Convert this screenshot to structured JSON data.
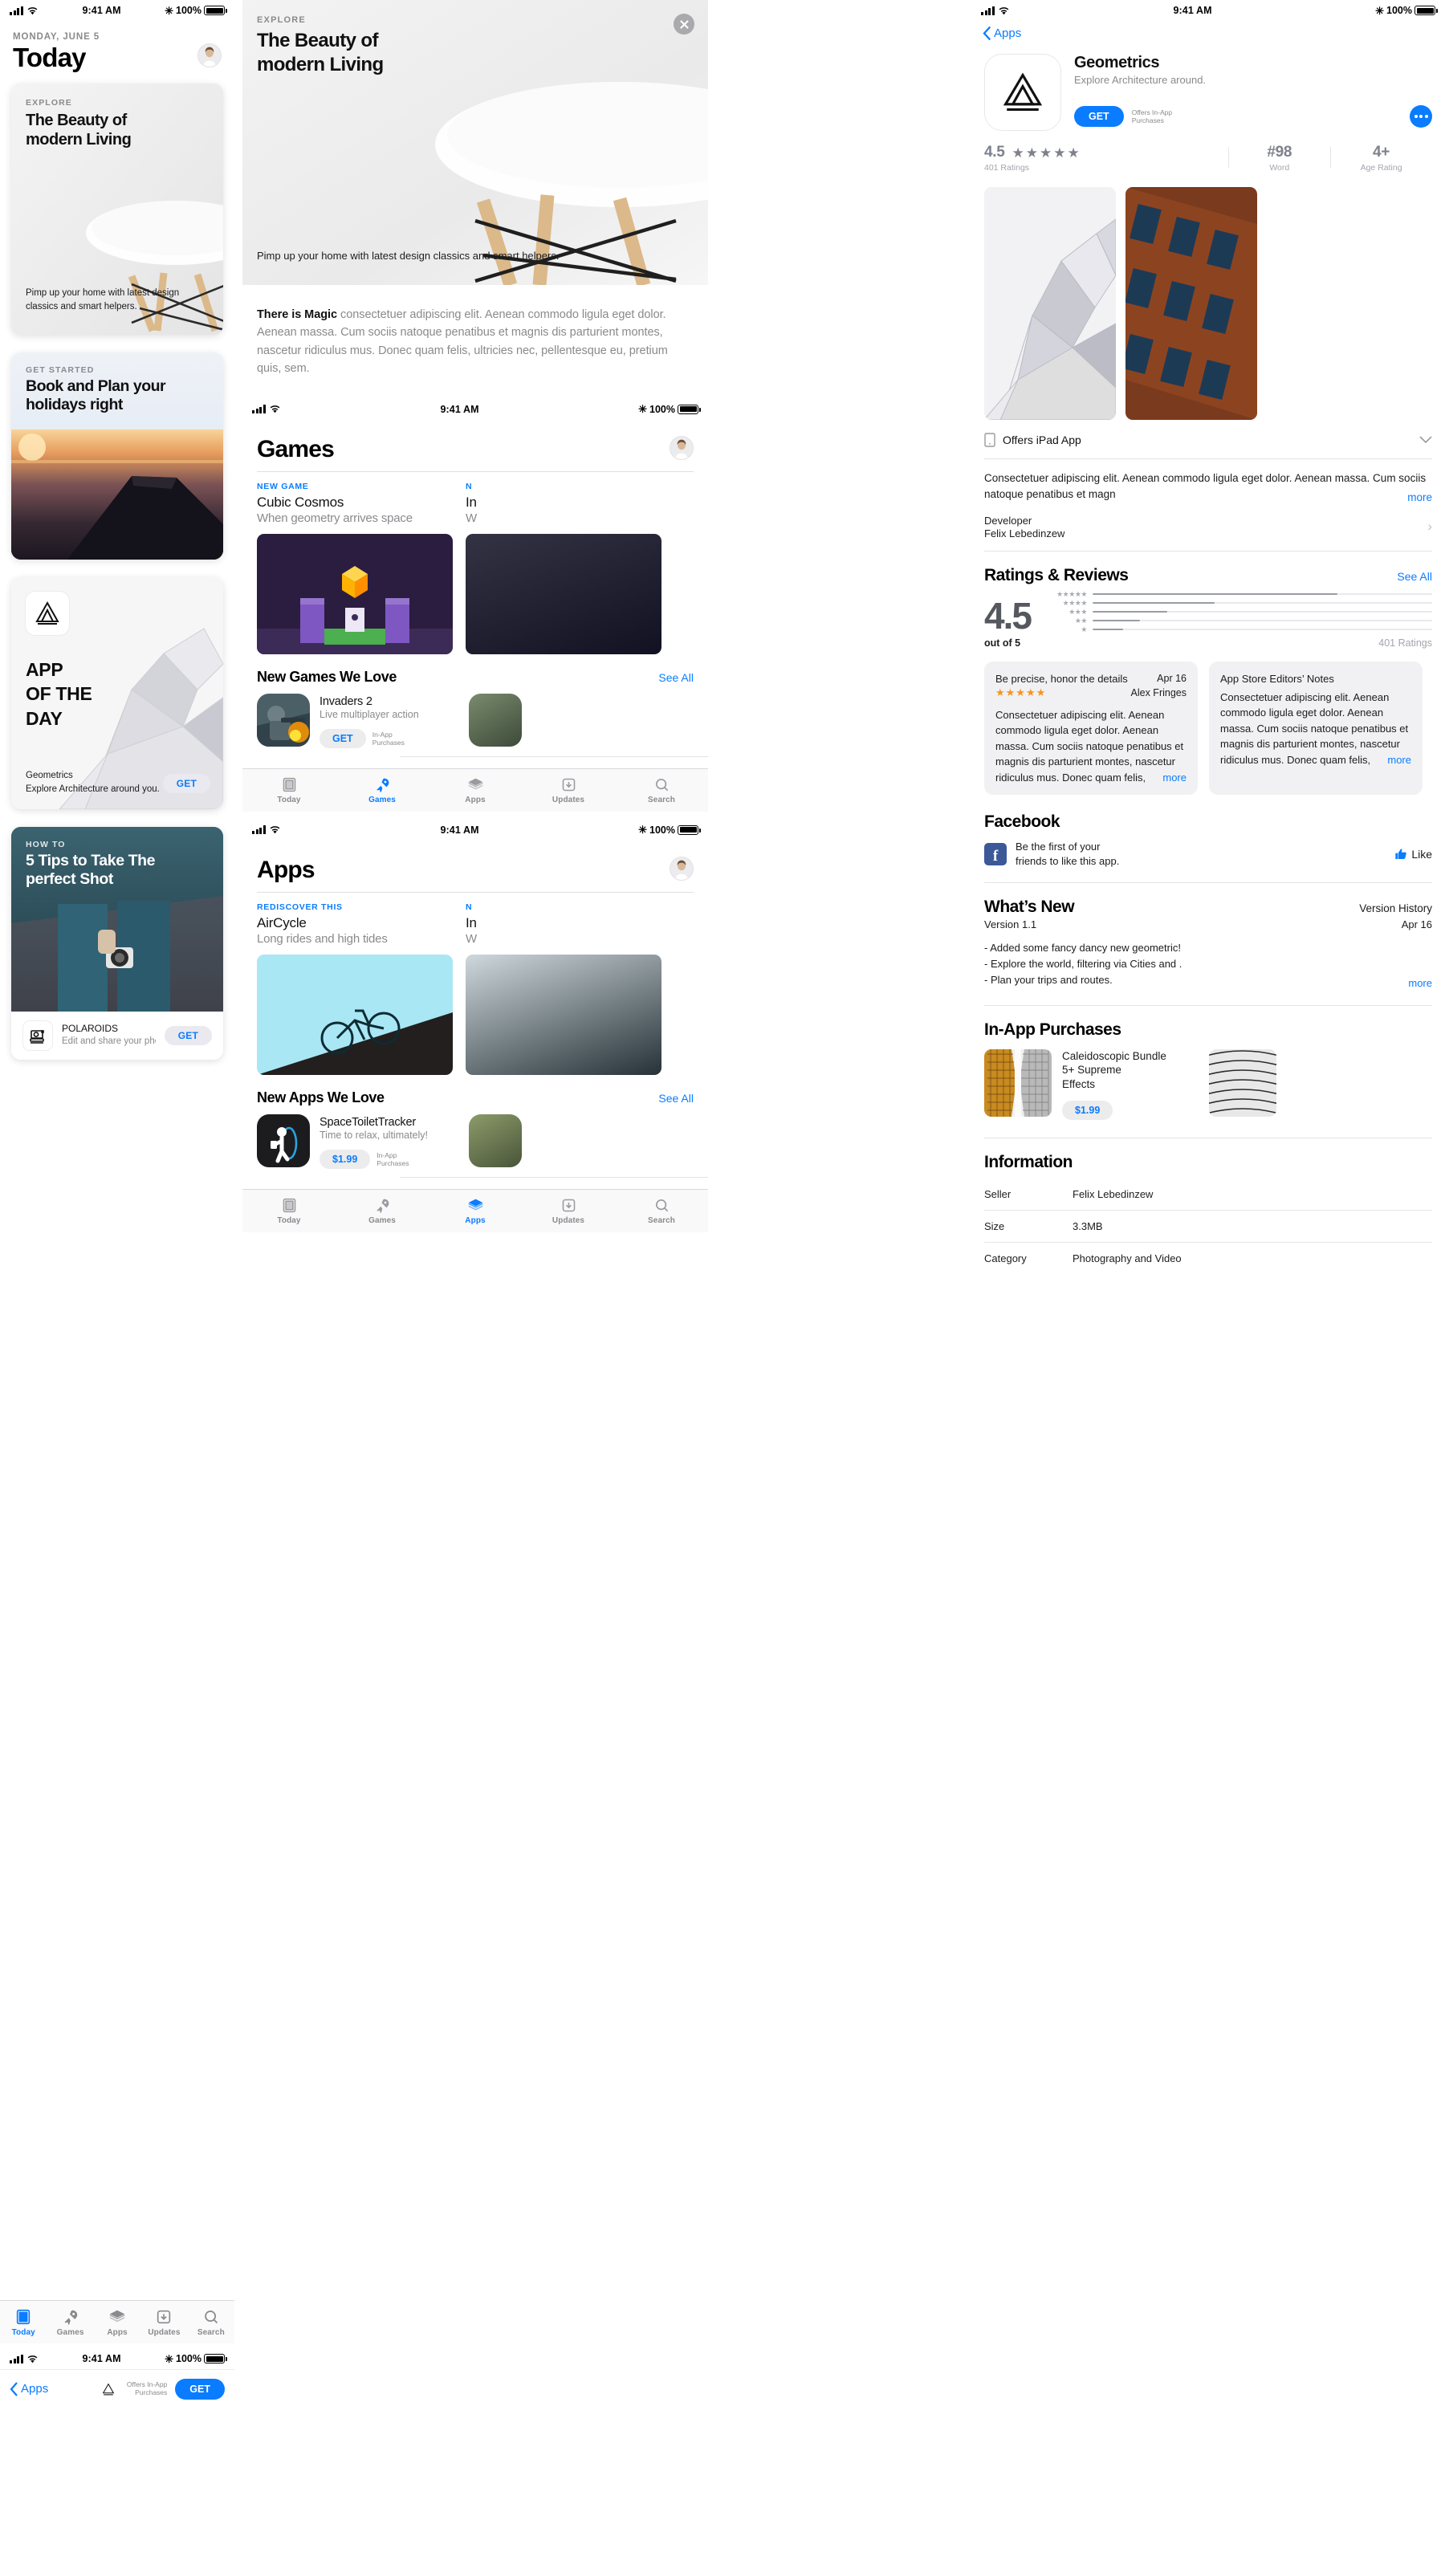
{
  "status_bar": {
    "time": "9:41 AM",
    "battery": "100%"
  },
  "today": {
    "date": "MONDAY, JUNE 5",
    "title": "Today",
    "avatar_name": "user-avatar",
    "cards": [
      {
        "kicker": "EXPLORE",
        "title": "The Beauty of\nmodern Living",
        "subtitle": "Pimp up your home with latest design classics and smart helpers."
      },
      {
        "kicker": "GET STARTED",
        "title": "Book and Plan your\nholidays right"
      },
      {
        "title": "APP\nOF THE\nDAY",
        "app_name": "Geometrics",
        "app_sub": "Explore Architecture around you.",
        "get_label": "GET"
      },
      {
        "kicker": "HOW TO",
        "title": "5 Tips to Take The\nperfect Shot",
        "app_name": "POLAROIDS",
        "app_sub": "Edit and share your photos",
        "get_label": "GET"
      }
    ],
    "tabs": [
      {
        "label": "Today",
        "icon": "today-icon",
        "active": true
      },
      {
        "label": "Games",
        "icon": "games-rocket-icon",
        "active": false
      },
      {
        "label": "Apps",
        "icon": "apps-stack-icon",
        "active": false
      },
      {
        "label": "Updates",
        "icon": "updates-download-icon",
        "active": false
      },
      {
        "label": "Search",
        "icon": "search-icon",
        "active": false
      }
    ],
    "mini_nav": {
      "back_label": "Apps",
      "iap_label": "Offers In-App\nPurchases",
      "get_label": "GET"
    }
  },
  "middle": {
    "hero": {
      "kicker": "EXPLORE",
      "title": "The Beauty of\nmodern Living",
      "subtitle": "Pimp up your home with latest design classics and smart helpers."
    },
    "article": {
      "lead": "There is Magic",
      "body": " consectetuer adipiscing elit. Aenean commodo ligula eget dolor. Aenean massa. Cum sociis natoque penatibus et magnis dis parturient montes, nascetur ridiculus mus. Donec quam felis, ultricies nec, pellentesque eu, pretium quis, sem."
    },
    "games": {
      "title": "Games",
      "featured": [
        {
          "kicker": "NEW GAME",
          "name": "Cubic Cosmos",
          "sub": "When geometry arrives space"
        },
        {
          "kicker": "N",
          "name": "In",
          "sub": "W"
        }
      ],
      "list_title": "New Games We Love",
      "see_all": "See All",
      "rows": [
        {
          "name": "Invaders 2",
          "sub": "Live multiplayer action",
          "price": "GET",
          "iap": "In-App\nPurchases"
        }
      ],
      "tabs": [
        {
          "label": "Today",
          "icon": "today-icon",
          "active": false
        },
        {
          "label": "Games",
          "icon": "games-rocket-icon",
          "active": true
        },
        {
          "label": "Apps",
          "icon": "apps-stack-icon",
          "active": false
        },
        {
          "label": "Updates",
          "icon": "updates-download-icon",
          "active": false
        },
        {
          "label": "Search",
          "icon": "search-icon",
          "active": false
        }
      ]
    },
    "apps": {
      "title": "Apps",
      "featured": [
        {
          "kicker": "REDISCOVER THIS",
          "name": "AirCycle",
          "sub": "Long rides and high tides"
        },
        {
          "kicker": "N",
          "name": "In",
          "sub": "W"
        }
      ],
      "list_title": "New Apps We Love",
      "see_all": "See All",
      "rows": [
        {
          "name": "SpaceToiletTracker",
          "sub": "Time to relax, ultimately!",
          "price": "$1.99",
          "iap": "In-App\nPurchases"
        }
      ],
      "tabs": [
        {
          "label": "Today",
          "icon": "today-icon",
          "active": false
        },
        {
          "label": "Games",
          "icon": "games-rocket-icon",
          "active": false
        },
        {
          "label": "Apps",
          "icon": "apps-stack-icon",
          "active": true
        },
        {
          "label": "Updates",
          "icon": "updates-download-icon",
          "active": false
        },
        {
          "label": "Search",
          "icon": "search-icon",
          "active": false
        }
      ]
    }
  },
  "detail": {
    "back_label": "Apps",
    "app_name": "Geometrics",
    "app_sub": "Explore Architecture around.",
    "get_label": "GET",
    "iap_label": "Offers In-App\nPurchases",
    "stats": [
      {
        "value": "4.5",
        "label": "401 Ratings",
        "kind": "rating"
      },
      {
        "value": "#98",
        "label": "Word",
        "kind": "rank"
      },
      {
        "value": "4+",
        "label": "Age Rating",
        "kind": "age"
      }
    ],
    "ipad_row": "Offers iPad App",
    "description": "Consectetuer adipiscing elit. Aenean commodo ligula eget dolor. Aenean massa. Cum sociis natoque penatibus et magn",
    "description_more": "more",
    "developer_label": "Developer",
    "developer_name": "Felix Lebedinzew",
    "ratings": {
      "title": "Ratings & Reviews",
      "see_all": "See All",
      "score": "4.5",
      "out_of": "out of 5",
      "count": "401 Ratings",
      "histogram": [
        {
          "stars": "★★★★★",
          "pct": 72
        },
        {
          "stars": "★★★★",
          "pct": 36
        },
        {
          "stars": "★★★",
          "pct": 22
        },
        {
          "stars": "★★",
          "pct": 14
        },
        {
          "stars": "★",
          "pct": 9
        }
      ]
    },
    "reviews": [
      {
        "title": "Be precise, honor the details",
        "date": "Apr 16",
        "stars": "★★★★★",
        "author": "Alex Fringes",
        "body": "Consectetuer adipiscing elit. Aenean commodo ligula eget dolor. Aenean massa. Cum sociis natoque penatibus et magnis dis parturient montes, nascetur ridiculus mus. Donec quam felis,",
        "more": "more"
      },
      {
        "title": "App Store Editors’ Notes",
        "date": "",
        "stars": "",
        "author": "",
        "body": "Consectetuer adipiscing elit. Aenean commodo ligula eget dolor. Aenean massa. Cum sociis natoque penatibus et magnis dis parturient montes, nascetur ridiculus mus. Donec quam felis,",
        "more": "more"
      }
    ],
    "facebook": {
      "title": "Facebook",
      "text": "Be the first of your\nfriends to like this app.",
      "like_label": "Like"
    },
    "whats_new": {
      "title": "What’s New",
      "version_history": "Version History",
      "version": "Version 1.1",
      "date": "Apr 16",
      "items": [
        "- Added some fancy dancy new geometric!",
        "- Explore the world, filtering via Cities and .",
        "- Plan your trips and routes."
      ],
      "more": "more"
    },
    "in_app_purchases": {
      "title": "In-App Purchases",
      "items": [
        {
          "name": "Caleidoscopic Bundle\n5+ Supreme\nEffects",
          "price": "$1.99"
        }
      ]
    },
    "information": {
      "title": "Information",
      "rows": [
        {
          "key": "Seller",
          "value": "Felix Lebedinzew"
        },
        {
          "key": "Size",
          "value": "3.3MB"
        },
        {
          "key": "Category",
          "value": "Photography and Video"
        }
      ]
    }
  }
}
